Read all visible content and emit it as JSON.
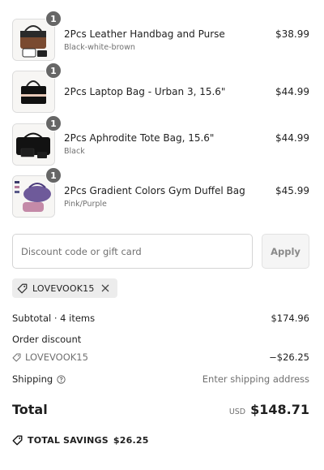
{
  "items": [
    {
      "name": "2Pcs Leather Handbag and Purse",
      "variant": "Black-white-brown",
      "price": "$38.99",
      "quantity": "1"
    },
    {
      "name": "2Pcs Laptop Bag - Urban 3, 15.6\"",
      "variant": "",
      "price": "$44.99",
      "quantity": "1"
    },
    {
      "name": "2Pcs Aphrodite Tote Bag, 15.6\"",
      "variant": "Black",
      "price": "$44.99",
      "quantity": "1"
    },
    {
      "name": "2Pcs Gradient Colors Gym Duffel Bag",
      "variant": "Pink/Purple",
      "price": "$45.99",
      "quantity": "1"
    }
  ],
  "discount": {
    "placeholder": "Discount code or gift card",
    "apply_label": "Apply",
    "applied_code": "LOVEVOOK15"
  },
  "summary": {
    "subtotal_label": "Subtotal · 4 items",
    "subtotal_value": "$174.96",
    "order_discount_label": "Order discount",
    "discount_code": "LOVEVOOK15",
    "discount_value": "−$26.25",
    "shipping_label": "Shipping",
    "shipping_value": "Enter shipping address",
    "total_label": "Total",
    "currency": "USD",
    "total_value": "$148.71",
    "savings_label": "TOTAL SAVINGS",
    "savings_value": "$26.25"
  },
  "icons": {
    "tag": "tag-icon",
    "close": "close-icon",
    "help": "help-circle-icon"
  }
}
